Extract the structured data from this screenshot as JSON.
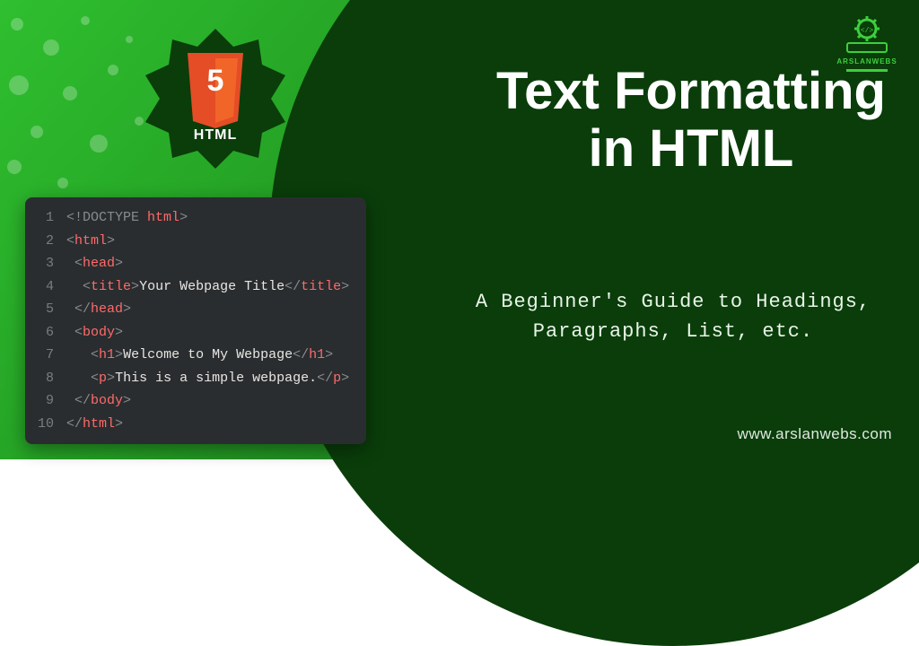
{
  "badge": {
    "label": "HTML",
    "five": "5"
  },
  "code": {
    "lines": [
      {
        "n": "1",
        "indent": "",
        "segs": [
          [
            "punct",
            "<!"
          ],
          [
            "doctype",
            "DOCTYPE"
          ],
          [
            "punct",
            " "
          ],
          [
            "tag",
            "html"
          ],
          [
            "punct",
            ">"
          ]
        ]
      },
      {
        "n": "2",
        "indent": "",
        "segs": [
          [
            "punct",
            "<"
          ],
          [
            "tag",
            "html"
          ],
          [
            "punct",
            ">"
          ]
        ]
      },
      {
        "n": "3",
        "indent": " ",
        "segs": [
          [
            "punct",
            "<"
          ],
          [
            "tag",
            "head"
          ],
          [
            "punct",
            ">"
          ]
        ]
      },
      {
        "n": "4",
        "indent": "  ",
        "segs": [
          [
            "punct",
            "<"
          ],
          [
            "tag",
            "title"
          ],
          [
            "punct",
            ">"
          ],
          [
            "text",
            "Your Webpage Title"
          ],
          [
            "punct",
            "</"
          ],
          [
            "tag",
            "title"
          ],
          [
            "punct",
            ">"
          ]
        ]
      },
      {
        "n": "5",
        "indent": " ",
        "segs": [
          [
            "punct",
            "</"
          ],
          [
            "tag",
            "head"
          ],
          [
            "punct",
            ">"
          ]
        ]
      },
      {
        "n": "6",
        "indent": " ",
        "segs": [
          [
            "punct",
            "<"
          ],
          [
            "tag",
            "body"
          ],
          [
            "punct",
            ">"
          ]
        ]
      },
      {
        "n": "7",
        "indent": "   ",
        "segs": [
          [
            "punct",
            "<"
          ],
          [
            "tag",
            "h1"
          ],
          [
            "punct",
            ">"
          ],
          [
            "text",
            "Welcome to My Webpage"
          ],
          [
            "punct",
            "</"
          ],
          [
            "tag",
            "h1"
          ],
          [
            "punct",
            ">"
          ]
        ]
      },
      {
        "n": "8",
        "indent": "   ",
        "segs": [
          [
            "punct",
            "<"
          ],
          [
            "tag",
            "p"
          ],
          [
            "punct",
            ">"
          ],
          [
            "text",
            "This is a simple webpage."
          ],
          [
            "punct",
            "</"
          ],
          [
            "tag",
            "p"
          ],
          [
            "punct",
            ">"
          ]
        ]
      },
      {
        "n": "9",
        "indent": " ",
        "segs": [
          [
            "punct",
            "</"
          ],
          [
            "tag",
            "body"
          ],
          [
            "punct",
            ">"
          ]
        ]
      },
      {
        "n": "10",
        "indent": "",
        "segs": [
          [
            "punct",
            "</"
          ],
          [
            "tag",
            "html"
          ],
          [
            "punct",
            ">"
          ]
        ]
      }
    ]
  },
  "heading": "Text Formatting in HTML",
  "subtitle": "A Beginner's Guide to Headings, Paragraphs, List, etc.",
  "url": "www.arslanwebs.com",
  "logo_text": "ARSLANWEBS",
  "colors": {
    "dark_green": "#0a3d0a",
    "light_green": "#24a024",
    "accent_green": "#3ece3e",
    "editor_bg": "#2a2d2f",
    "tag_red": "#ff6a6a"
  }
}
